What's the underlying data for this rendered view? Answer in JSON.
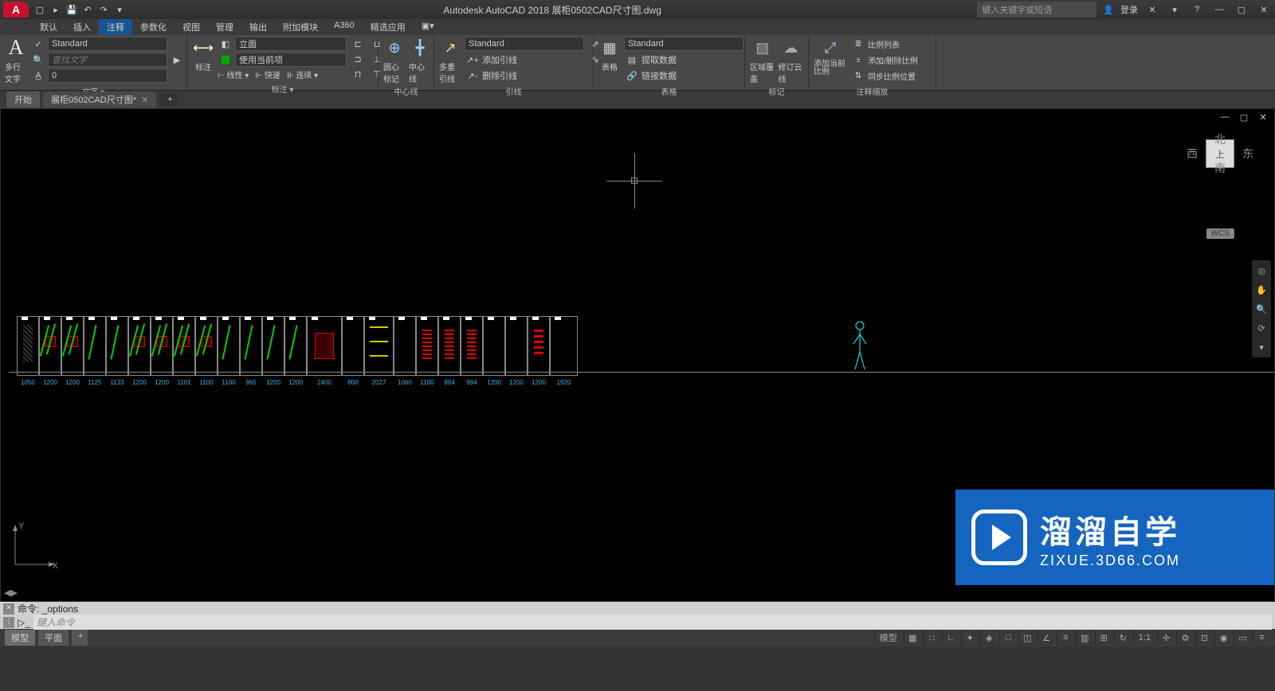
{
  "app": {
    "title": "Autodesk AutoCAD 2018   展柜0502CAD尺寸图.dwg",
    "login": "登录",
    "search_ph": "键入关键字或短语"
  },
  "menu": [
    "默认",
    "插入",
    "注释",
    "参数化",
    "视图",
    "管理",
    "输出",
    "附加模块",
    "A360",
    "精选应用"
  ],
  "menu_active_index": 2,
  "ribbon": {
    "text": {
      "label": "文字 ▾",
      "big": "多行文字",
      "style": "Standard",
      "find_ph": "查找文字",
      "height": "0"
    },
    "annot": {
      "label": "标注 ▾",
      "big": "标注",
      "style": "立面",
      "use": "使用当前项",
      "linear": "线性",
      "quick": "快速",
      "cont": "连续"
    },
    "center": {
      "label": "中心线",
      "b1": "圆心标记",
      "b2": "中心线"
    },
    "leader": {
      "label": "引线",
      "big": "多重引线",
      "style": "Standard",
      "add": "添加引线",
      "remove": "删除引线"
    },
    "table": {
      "label": "表格",
      "big": "表格",
      "style": "Standard",
      "extract": "提取数据",
      "link": "链接数据"
    },
    "markup": {
      "label": "标记",
      "b1": "区域覆盖",
      "b2": "修订云线"
    },
    "scale": {
      "label": "注释缩放",
      "big1": "添加当前比例",
      "l1": "比例列表",
      "l2": "添加/删除比例",
      "l3": "同步比例位置"
    }
  },
  "doc_tabs": {
    "start": "开始",
    "file": "展柜0502CAD尺寸图*"
  },
  "viewcube": {
    "n": "北",
    "s": "南",
    "e": "东",
    "w": "西",
    "top": "上",
    "wcs": "WCS"
  },
  "ucs": {
    "x": "X",
    "y": "Y"
  },
  "dims": [
    "1050",
    "1200",
    "1200",
    "1125",
    "1133",
    "1200",
    "1200",
    "1101",
    "1100",
    "1100",
    "965",
    "1200",
    "1200",
    "2400",
    "800",
    "2027",
    "1060",
    "1100",
    "994",
    "994",
    "1200",
    "1200",
    "1200",
    "1920"
  ],
  "cmd": {
    "last": "命令: _options",
    "prompt": "键入命令"
  },
  "status": {
    "model": "模型",
    "layout": "平面",
    "scale": "1:1",
    "snap": "模型"
  },
  "watermark": {
    "big": "溜溜自学",
    "small": "ZIXUE.3D66.COM"
  }
}
